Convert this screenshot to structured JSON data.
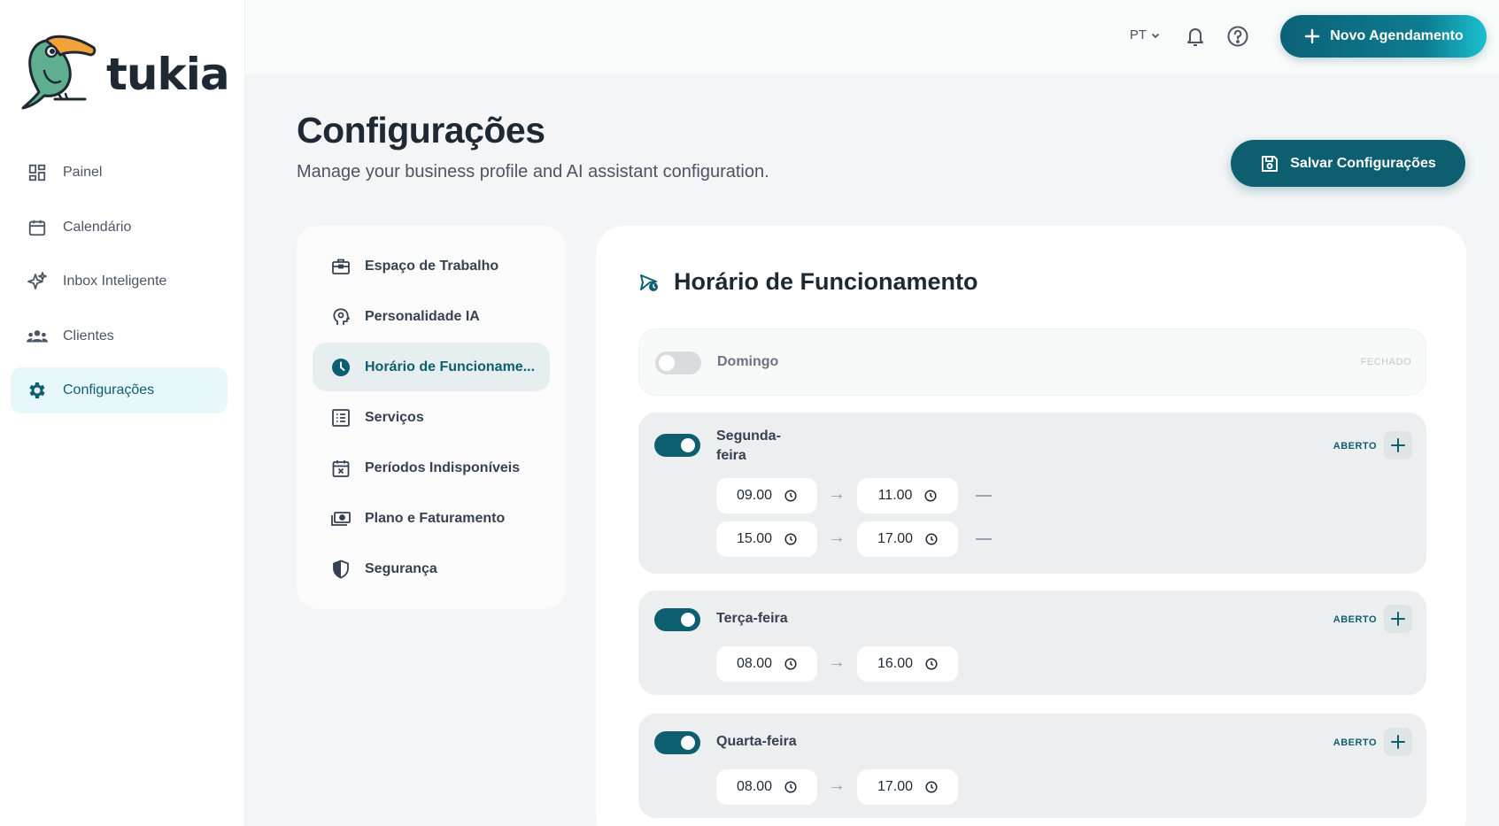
{
  "brand": {
    "name": "tukia"
  },
  "sidebar": {
    "items": [
      {
        "label": "Painel",
        "icon": "dashboard-icon"
      },
      {
        "label": "Calendário",
        "icon": "calendar-icon"
      },
      {
        "label": "Inbox Inteligente",
        "icon": "sparkle-icon"
      },
      {
        "label": "Clientes",
        "icon": "users-icon"
      },
      {
        "label": "Configurações",
        "icon": "gear-icon",
        "active": true
      }
    ]
  },
  "topbar": {
    "language": "PT",
    "new_button": "Novo Agendamento"
  },
  "header": {
    "title": "Configurações",
    "subtitle": "Manage your business profile and AI assistant configuration.",
    "save_button": "Salvar Configurações"
  },
  "settings_menu": {
    "items": [
      {
        "label": "Espaço de Trabalho",
        "icon": "briefcase-icon"
      },
      {
        "label": "Personalidade IA",
        "icon": "ai-head-icon"
      },
      {
        "label": "Horário de Funcioname...",
        "icon": "clock-icon",
        "active": true
      },
      {
        "label": "Serviços",
        "icon": "list-icon"
      },
      {
        "label": "Períodos Indisponíveis",
        "icon": "calendar-x-icon"
      },
      {
        "label": "Plano e Faturamento",
        "icon": "money-icon"
      },
      {
        "label": "Segurança",
        "icon": "shield-icon"
      }
    ]
  },
  "hours": {
    "title": "Horário de Funcionamento",
    "days": [
      {
        "name": "Domingo",
        "enabled": false,
        "status": "FECHADO",
        "slots": []
      },
      {
        "name_line1": "Segunda-",
        "name_line2": "feira",
        "enabled": true,
        "status": "ABERTO",
        "slots": [
          {
            "start": "09.00",
            "end": "11.00"
          },
          {
            "start": "15.00",
            "end": "17.00"
          }
        ]
      },
      {
        "name": "Terça-feira",
        "enabled": true,
        "status": "ABERTO",
        "slots": [
          {
            "start": "08.00",
            "end": "16.00"
          }
        ]
      },
      {
        "name": "Quarta-feira",
        "enabled": true,
        "status": "ABERTO",
        "slots": [
          {
            "start": "08.00",
            "end": "17.00"
          }
        ]
      }
    ]
  },
  "colors": {
    "primary": "#0d5f70",
    "accent": "#1ac0cf",
    "active_bg": "#e8f8fa"
  }
}
